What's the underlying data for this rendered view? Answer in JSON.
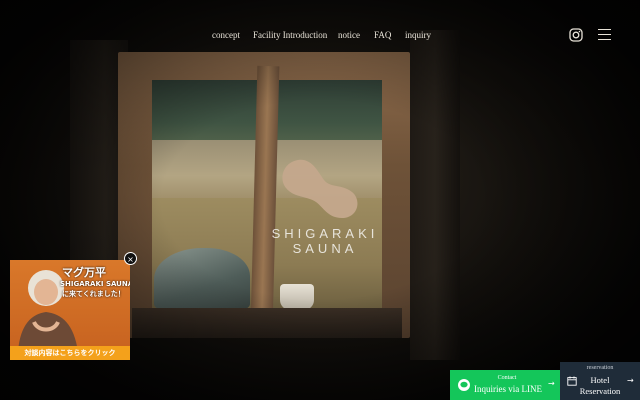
{
  "nav": {
    "links": [
      "concept",
      "Facility Introduction",
      "notice",
      "FAQ",
      "inquiry"
    ]
  },
  "hero": {
    "brand": "SHIGARAKI SAUNA",
    "logo_color": "#c4a88c"
  },
  "video_popup": {
    "title": "マグ万平",
    "subtitle1": "SHIGARAKI SAUNA",
    "subtitle2": "に来てくれました！",
    "cta": "対談内容はこちらをクリック",
    "close": "×"
  },
  "line_button": {
    "small": "Contact",
    "label": "Inquiries via LINE",
    "arrow": "→",
    "color": "#14c65a"
  },
  "hotel_button": {
    "small": "reservation",
    "label_line1": "Hotel",
    "label_line2": "Reservation",
    "arrow": "→",
    "color": "#1f2c39"
  },
  "icons": [
    "instagram-icon",
    "hamburger-menu-icon",
    "line-icon",
    "calendar-icon",
    "close-icon"
  ]
}
